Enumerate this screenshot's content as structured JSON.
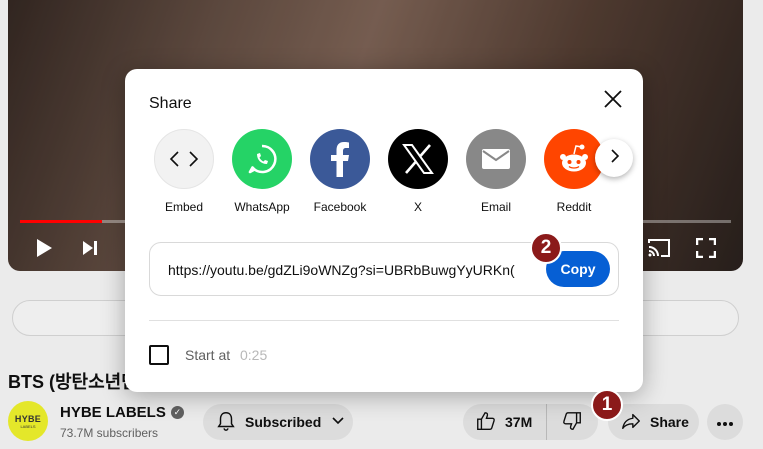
{
  "page": {
    "video_title": "BTS (방탄소년단)",
    "channel_name": "HYBE LABELS",
    "channel_logo_text": "HYBE",
    "channel_logo_sub": "LABELS",
    "subscribers": "73.7M subscribers",
    "subscribed_label": "Subscribed",
    "like_count": "37M",
    "share_label": "Share",
    "progress_fraction": 0.115
  },
  "dialog": {
    "title": "Share",
    "targets": [
      {
        "label": "Embed",
        "icon": "embed-icon",
        "color": "#f2f2f2"
      },
      {
        "label": "WhatsApp",
        "icon": "whatsapp-icon",
        "color": "#25d366"
      },
      {
        "label": "Facebook",
        "icon": "facebook-icon",
        "color": "#3b5998"
      },
      {
        "label": "X",
        "icon": "x-icon",
        "color": "#000000"
      },
      {
        "label": "Email",
        "icon": "email-icon",
        "color": "#888888"
      },
      {
        "label": "Reddit",
        "icon": "reddit-icon",
        "color": "#ff4500"
      }
    ],
    "url": "https://youtu.be/gdZLi9oWNZg?si=UBRbBuwgYyURKn(",
    "copy_label": "Copy",
    "start_at_label": "Start at",
    "start_time": "0:25"
  },
  "markers": {
    "first": "1",
    "second": "2",
    "color": "#8b1a1a"
  }
}
